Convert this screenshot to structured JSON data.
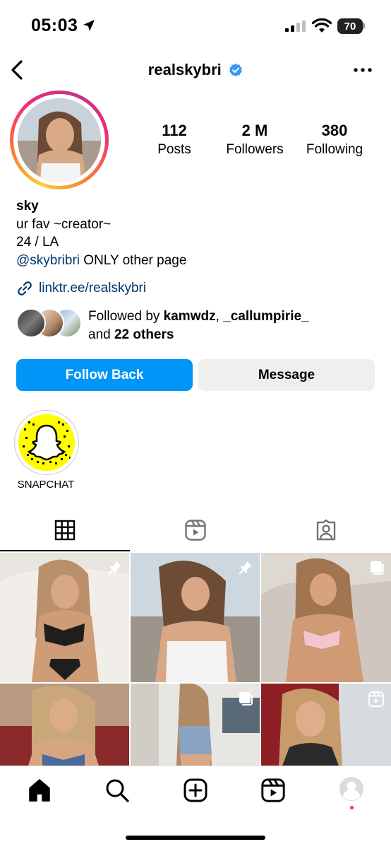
{
  "status_bar": {
    "time": "05:03",
    "battery": "70"
  },
  "header": {
    "username": "realskybri"
  },
  "stats": [
    {
      "value": "112",
      "label": "Posts"
    },
    {
      "value": "2 M",
      "label": "Followers"
    },
    {
      "value": "380",
      "label": "Following"
    }
  ],
  "bio": {
    "name": "sky",
    "line1": "ur fav ~creator~",
    "line2": "24 / LA",
    "mention": "@skybribri",
    "mention_suffix": " ONLY other page",
    "link": "linktr.ee/realskybri"
  },
  "followed_by": {
    "prefix": "Followed by ",
    "user1": "kamwdz",
    "sep": ", ",
    "user2": "_callumpirie_",
    "and": "and ",
    "others": "22 others"
  },
  "actions": {
    "follow_back": "Follow Back",
    "message": "Message"
  },
  "highlights": [
    {
      "label": "SNAPCHAT"
    }
  ],
  "colors": {
    "accent": "#0095f6",
    "link": "#00376b",
    "verified": "#3897f0",
    "snap_yellow": "#fffc00"
  },
  "icons": [
    "back-icon",
    "verified-badge-icon",
    "more-icon",
    "link-icon",
    "grid-icon",
    "reels-icon",
    "tagged-icon",
    "home-icon",
    "search-icon",
    "create-icon",
    "reels-nav-icon",
    "profile-icon",
    "pin-icon",
    "multi-post-icon"
  ]
}
